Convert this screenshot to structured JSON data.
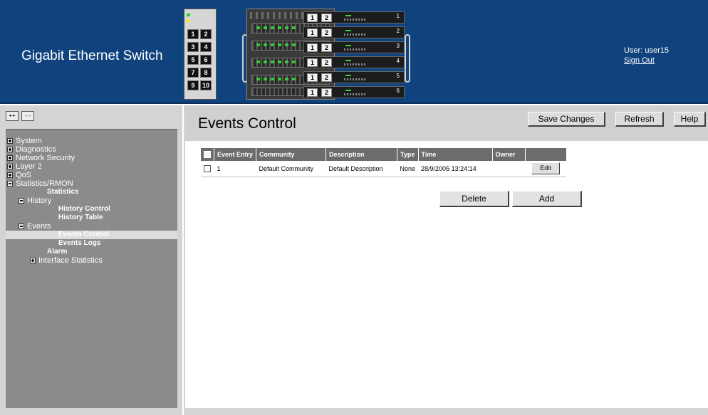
{
  "header": {
    "title": "Gigabit Ethernet Switch",
    "user_label": "User: user15",
    "signout_label": "Sign Out"
  },
  "devices": {
    "side_ports": [
      "1",
      "2",
      "3",
      "4",
      "5",
      "6",
      "7",
      "8",
      "9",
      "10"
    ],
    "blade_ports": [
      "1",
      "2"
    ],
    "blade_indices": [
      "1",
      "2",
      "3",
      "4",
      "5",
      "6"
    ]
  },
  "sidebar": {
    "expand_all_label": "++",
    "collapse_all_label": "--",
    "tree": [
      {
        "label": "System",
        "level": 0,
        "icon": "plus-box-icon"
      },
      {
        "label": "Diagnostics",
        "level": 0,
        "icon": "plus-box-icon"
      },
      {
        "label": "Network Security",
        "level": 0,
        "icon": "plus-box-icon"
      },
      {
        "label": "Layer 2",
        "level": 0,
        "icon": "plus-box-icon"
      },
      {
        "label": "QoS",
        "level": 0,
        "icon": "plus-box-icon"
      },
      {
        "label": "Statistics/RMON",
        "level": 0,
        "icon": "minus-box-icon"
      },
      {
        "label": "Statistics",
        "level": 1,
        "icon": "none"
      },
      {
        "label": "History",
        "level": 1,
        "icon": "minus-box-icon"
      },
      {
        "label": "History Control",
        "level": 2,
        "icon": "none"
      },
      {
        "label": "History Table",
        "level": 2,
        "icon": "none"
      },
      {
        "label": "Events",
        "level": 1,
        "icon": "minus-box-icon"
      },
      {
        "label": "Events Control",
        "level": 2,
        "icon": "none",
        "selected": true
      },
      {
        "label": "Events Logs",
        "level": 2,
        "icon": "none"
      },
      {
        "label": "Alarm",
        "level": 1,
        "icon": "none"
      },
      {
        "label": "Interface Statistics",
        "level": 1,
        "icon": "plus-box-icon"
      }
    ]
  },
  "main": {
    "title": "Events Control",
    "save_label": "Save Changes",
    "refresh_label": "Refresh",
    "help_label": "Help",
    "table": {
      "columns": [
        "Event Entry",
        "Community",
        "Description",
        "Type",
        "Time",
        "Owner"
      ],
      "rows": [
        {
          "entry": "1",
          "community": "Default Community",
          "description": "Default Description",
          "type": "None",
          "time": "28/9/2005 13:24:14",
          "owner": "",
          "edit_label": "Edit"
        }
      ]
    },
    "delete_label": "Delete",
    "add_label": "Add"
  },
  "colors": {
    "header_bg": "#10437e",
    "sidebar_bg": "#d4d4d4",
    "tree_bg": "#8b8b8b",
    "table_header_bg": "#6c6c6c"
  }
}
